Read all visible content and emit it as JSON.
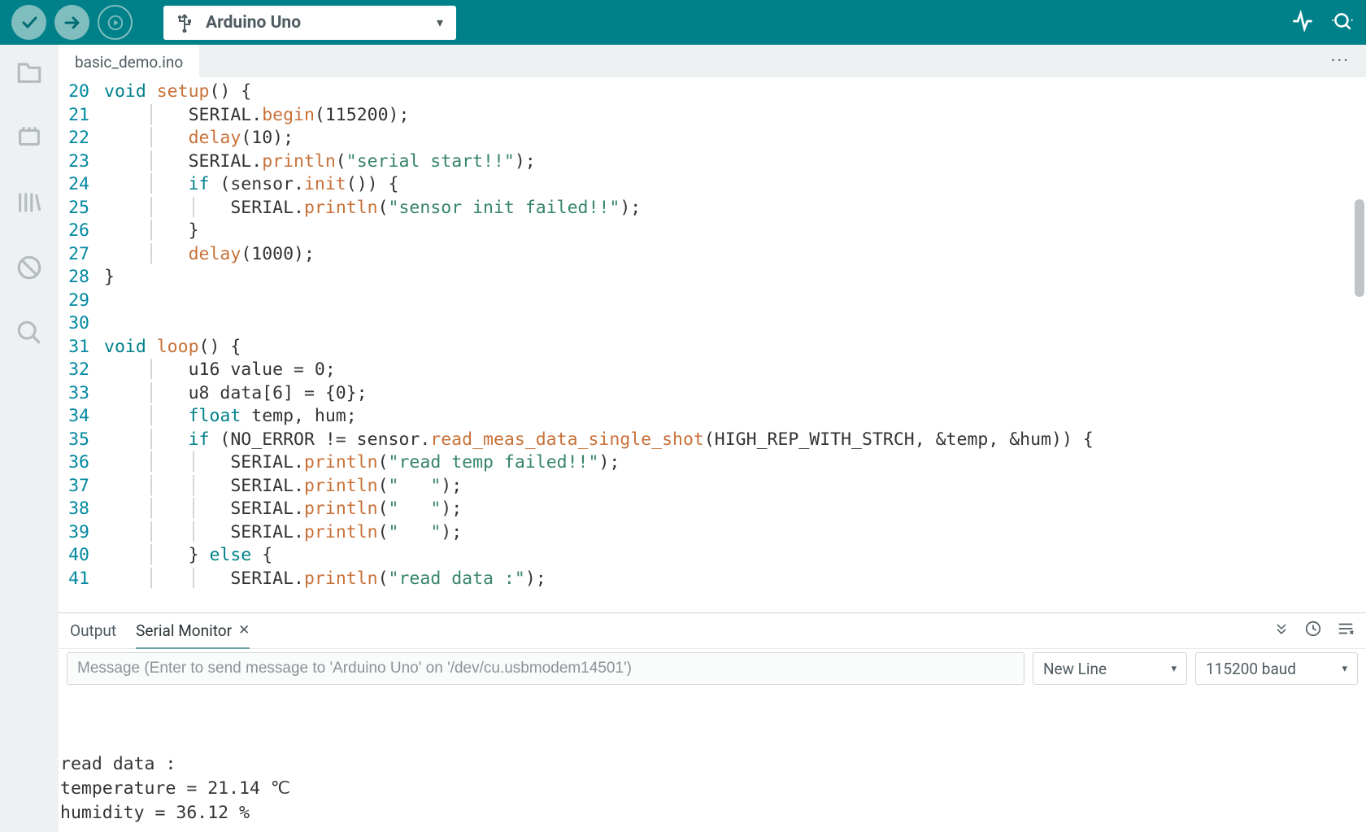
{
  "toolbar": {
    "board_name": "Arduino Uno"
  },
  "tabs": {
    "active": "basic_demo.ino"
  },
  "editor": {
    "first_line": 20,
    "lines": [
      {
        "n": 20,
        "html": "<span class='kw'>void</span> <span class='fn'>setup</span>() {"
      },
      {
        "n": 21,
        "html": "    <span class='guide'>│</span>   SERIAL.<span class='fn'>begin</span>(115200);"
      },
      {
        "n": 22,
        "html": "    <span class='guide'>│</span>   <span class='fn'>delay</span>(10);"
      },
      {
        "n": 23,
        "html": "    <span class='guide'>│</span>   SERIAL.<span class='fn'>println</span>(<span class='str'>\"serial start!!\"</span>);"
      },
      {
        "n": 24,
        "html": "    <span class='guide'>│</span>   <span class='kw'>if</span> (sensor.<span class='fn'>init</span>()) {"
      },
      {
        "n": 25,
        "html": "    <span class='guide'>│</span>   <span class='guide'>│</span>   SERIAL.<span class='fn'>println</span>(<span class='str'>\"sensor init failed!!\"</span>);"
      },
      {
        "n": 26,
        "html": "    <span class='guide'>│</span>   }"
      },
      {
        "n": 27,
        "html": "    <span class='guide'>│</span>   <span class='fn'>delay</span>(1000);"
      },
      {
        "n": 28,
        "html": "}"
      },
      {
        "n": 29,
        "html": ""
      },
      {
        "n": 30,
        "html": ""
      },
      {
        "n": 31,
        "html": "<span class='kw'>void</span> <span class='fn'>loop</span>() {"
      },
      {
        "n": 32,
        "html": "    <span class='guide'>│</span>   u16 value = 0;"
      },
      {
        "n": 33,
        "html": "    <span class='guide'>│</span>   u8 data[6] = {0};"
      },
      {
        "n": 34,
        "html": "    <span class='guide'>│</span>   <span class='kw'>float</span> temp, hum;"
      },
      {
        "n": 35,
        "html": "    <span class='guide'>│</span>   <span class='kw'>if</span> (NO_ERROR != sensor.<span class='fn'>read_meas_data_single_shot</span>(HIGH_REP_WITH_STRCH, &amp;temp, &amp;hum)) {"
      },
      {
        "n": 36,
        "html": "    <span class='guide'>│</span>   <span class='guide'>│</span>   SERIAL.<span class='fn'>println</span>(<span class='str'>\"read temp failed!!\"</span>);"
      },
      {
        "n": 37,
        "html": "    <span class='guide'>│</span>   <span class='guide'>│</span>   SERIAL.<span class='fn'>println</span>(<span class='str'>\"   \"</span>);"
      },
      {
        "n": 38,
        "html": "    <span class='guide'>│</span>   <span class='guide'>│</span>   SERIAL.<span class='fn'>println</span>(<span class='str'>\"   \"</span>);"
      },
      {
        "n": 39,
        "html": "    <span class='guide'>│</span>   <span class='guide'>│</span>   SERIAL.<span class='fn'>println</span>(<span class='str'>\"   \"</span>);"
      },
      {
        "n": 40,
        "html": "    <span class='guide'>│</span>   } <span class='kw'>else</span> {"
      },
      {
        "n": 41,
        "html": "    <span class='guide'>│</span>   <span class='guide'>│</span>   SERIAL.<span class='fn'>println</span>(<span class='str'>\"read data :\"</span>);"
      }
    ]
  },
  "panel": {
    "tab_output": "Output",
    "tab_serial": "Serial Monitor",
    "msg_placeholder": "Message (Enter to send message to 'Arduino Uno' on '/dev/cu.usbmodem14501')",
    "line_ending": "New Line",
    "baud": "115200 baud",
    "output": "\nread data :\ntemperature = 21.14 ℃\nhumidity = 36.12 %"
  }
}
